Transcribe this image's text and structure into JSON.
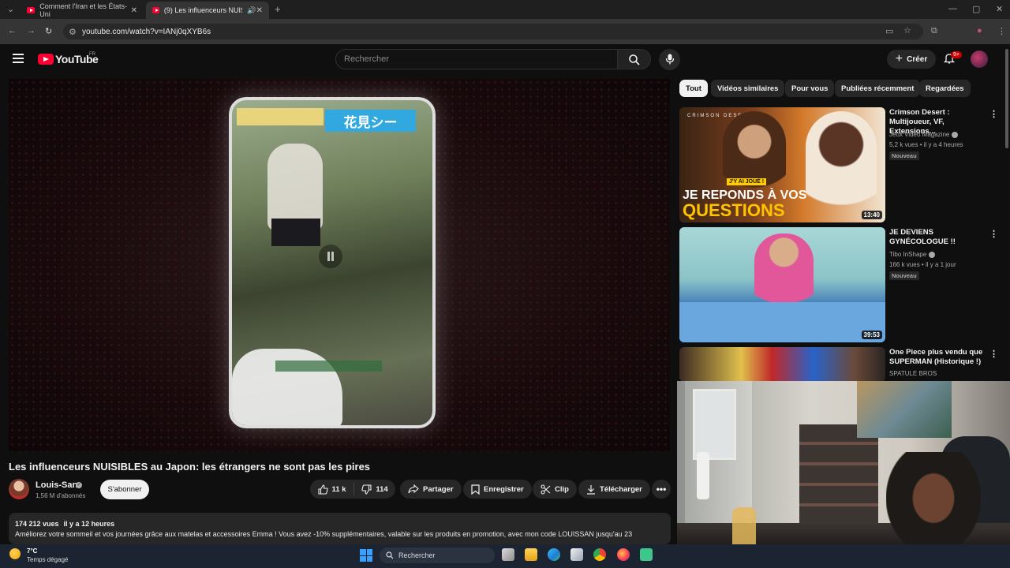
{
  "browser": {
    "tabs": [
      {
        "title": "Comment l'Iran et les États-Uni",
        "active": false
      },
      {
        "title": "(9) Les influenceurs NUISIBLE",
        "active": true
      }
    ],
    "url": "youtube.com/watch?v=IANj0qXYB6s"
  },
  "youtube": {
    "logo_text": "YouTube",
    "region": "FR",
    "search_placeholder": "Rechercher",
    "create_label": "Créer",
    "notif_count": "9+"
  },
  "video": {
    "overlay_text": "花見シー",
    "title": "Les influenceurs NUISIBLES au Japon: les étrangers ne sont pas les pires",
    "channel": "Louis-San",
    "subscribers": "1,56 M d'abonnés",
    "subscribe_label": "S'abonner",
    "likes": "11 k",
    "dislikes": "114",
    "share_label": "Partager",
    "save_label": "Enregistrer",
    "clip_label": "Clip",
    "download_label": "Télécharger",
    "more_label": "•••",
    "views": "174 212 vues",
    "posted": "il y a 12 heures",
    "description": "Améliorez votre sommeil et vos journées grâce aux matelas et accessoires Emma ! Vous avez -10% supplémentaires, valable sur les produits en promotion, avec mon code LOUISSAN jusqu'au 23"
  },
  "filters": [
    "Tout",
    "Vidéos similaires",
    "Pour vous",
    "Publiées récemment",
    "Regardées"
  ],
  "recommendations": [
    {
      "title": "Crimson Desert : Multijoueur, VF, Extensions...",
      "channel": "Jeux Vidéo Magazine",
      "views": "5,2 k vues • il y a 4 heures",
      "badge": "Nouveau",
      "duration": "13:40",
      "thumb_text_1": "J'Y AI JOUÉ !",
      "thumb_text_2": "JE REPONDS À VOS",
      "thumb_text_3": "QUESTIONS",
      "thumb_brand": "CRIMSON DESERT"
    },
    {
      "title": "JE DEVIENS GYNÉCOLOGUE !!",
      "channel": "Tibo InShape",
      "views": "166 k vues • il y a 1 jour",
      "badge": "Nouveau",
      "duration": "39:53"
    },
    {
      "title": "One Piece plus vendu que SUPERMAN (Historique !)",
      "channel": "SPATULE BROS",
      "views": "",
      "badge": "",
      "duration": ""
    }
  ],
  "taskbar": {
    "temperature": "7°C",
    "weather": "Temps dégagé",
    "search_label": "Rechercher"
  },
  "colors": {
    "accent": "#ff0033",
    "background": "#0f0f0f",
    "chip": "#272727"
  }
}
